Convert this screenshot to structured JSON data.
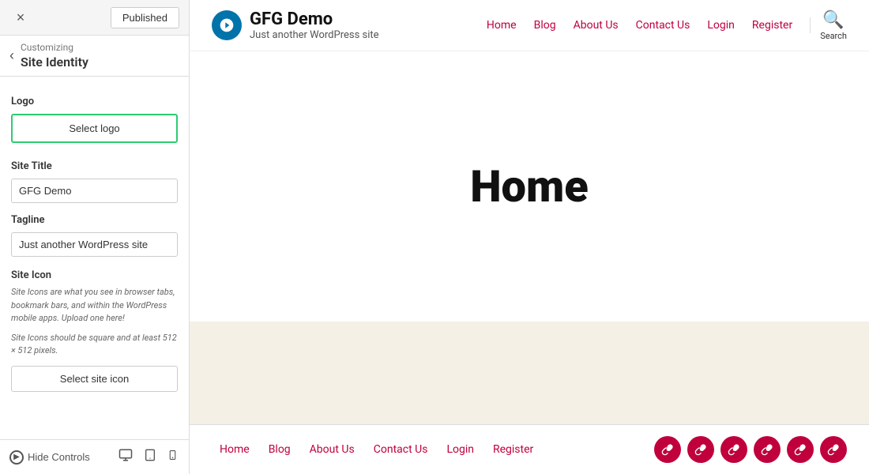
{
  "header": {
    "close_label": "×",
    "published_label": "Published"
  },
  "panel": {
    "nav_title": "Customizing",
    "main_title": "Site Identity",
    "logo_label": "Logo",
    "select_logo_label": "Select logo",
    "site_title_label": "Site Title",
    "site_title_value": "GFG Demo",
    "tagline_label": "Tagline",
    "tagline_value": "Just another WordPress site",
    "site_icon_label": "Site Icon",
    "site_icon_desc": "Site Icons are what you see in browser tabs, bookmark bars, and within the WordPress mobile apps. Upload one here!",
    "site_icon_note": "Site Icons should be square and at least 512 × 512 pixels.",
    "select_icon_label": "Select site icon",
    "hide_controls_label": "Hide Controls"
  },
  "site": {
    "brand_title": "GFG Demo",
    "brand_tagline": "Just another WordPress site",
    "nav_items": [
      "Home",
      "Blog",
      "About Us",
      "Contact Us",
      "Login",
      "Register"
    ],
    "search_label": "Search",
    "hero_title": "Home",
    "footer_items": [
      "Home",
      "Blog",
      "About Us",
      "Contact Us",
      "Login",
      "Register"
    ],
    "social_icons": [
      "link",
      "link",
      "link",
      "link",
      "link",
      "link"
    ]
  },
  "colors": {
    "accent": "#c0003c",
    "brand_bg": "#0073aa",
    "tan_bg": "#f5f0e6"
  }
}
